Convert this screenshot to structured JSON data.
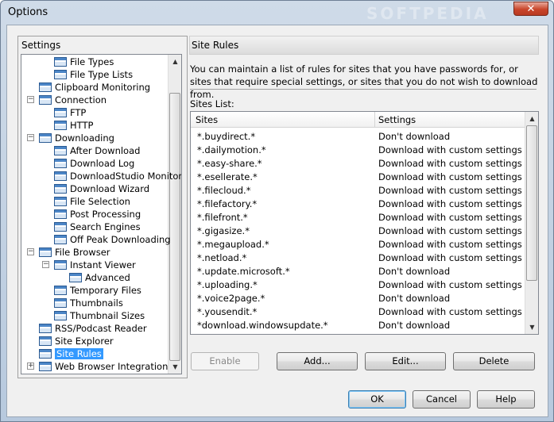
{
  "window": {
    "title": "Options",
    "close_label": "✕",
    "watermark": "SOFTPEDIA"
  },
  "settings": {
    "heading": "Settings",
    "tree": [
      {
        "label": "File Types",
        "level": 2
      },
      {
        "label": "File Type Lists",
        "level": 2
      },
      {
        "label": "Clipboard Monitoring",
        "level": 1
      },
      {
        "label": "Connection",
        "level": 1,
        "expander": "−"
      },
      {
        "label": "FTP",
        "level": 2
      },
      {
        "label": "HTTP",
        "level": 2
      },
      {
        "label": "Downloading",
        "level": 1,
        "expander": "−"
      },
      {
        "label": "After Download",
        "level": 2
      },
      {
        "label": "Download Log",
        "level": 2
      },
      {
        "label": "DownloadStudio Monitor",
        "level": 2
      },
      {
        "label": "Download Wizard",
        "level": 2
      },
      {
        "label": "File Selection",
        "level": 2
      },
      {
        "label": "Post Processing",
        "level": 2
      },
      {
        "label": "Search Engines",
        "level": 2
      },
      {
        "label": "Off Peak Downloading",
        "level": 2
      },
      {
        "label": "File Browser",
        "level": 1,
        "expander": "−"
      },
      {
        "label": "Instant Viewer",
        "level": 2,
        "expander": "−"
      },
      {
        "label": "Advanced",
        "level": 3
      },
      {
        "label": "Temporary Files",
        "level": 2
      },
      {
        "label": "Thumbnails",
        "level": 2
      },
      {
        "label": "Thumbnail Sizes",
        "level": 2
      },
      {
        "label": "RSS/Podcast Reader",
        "level": 1
      },
      {
        "label": "Site Explorer",
        "level": 1
      },
      {
        "label": "Site Rules",
        "level": 1,
        "selected": true
      },
      {
        "label": "Web Browser Integration",
        "level": 1,
        "expander": "+"
      }
    ]
  },
  "site_rules": {
    "header": "Site Rules",
    "description": "You can maintain a list of rules for sites that you have passwords for, or sites that require special settings, or sites that you do not wish to download from.",
    "list_label": "Sites List:",
    "columns": [
      "Sites",
      "Settings"
    ],
    "rows": [
      [
        "*.buydirect.*",
        "Don't download"
      ],
      [
        "*.dailymotion.*",
        "Download with custom settings"
      ],
      [
        "*.easy-share.*",
        "Download with custom settings"
      ],
      [
        "*.esellerate.*",
        "Download with custom settings"
      ],
      [
        "*.filecloud.*",
        "Download with custom settings"
      ],
      [
        "*.filefactory.*",
        "Download with custom settings"
      ],
      [
        "*.filefront.*",
        "Download with custom settings"
      ],
      [
        "*.gigasize.*",
        "Download with custom settings"
      ],
      [
        "*.megaupload.*",
        "Download with custom settings"
      ],
      [
        "*.netload.*",
        "Download with custom settings"
      ],
      [
        "*.update.microsoft.*",
        "Don't download"
      ],
      [
        "*.uploading.*",
        "Download with custom settings"
      ],
      [
        "*.voice2page.*",
        "Don't download"
      ],
      [
        "*.yousendit.*",
        "Download with custom settings"
      ],
      [
        "*download.windowsupdate.*",
        "Don't download"
      ]
    ],
    "buttons": {
      "enable": "Enable",
      "add": "Add...",
      "edit": "Edit...",
      "delete": "Delete"
    }
  },
  "footer": {
    "ok": "OK",
    "cancel": "Cancel",
    "help": "Help"
  }
}
